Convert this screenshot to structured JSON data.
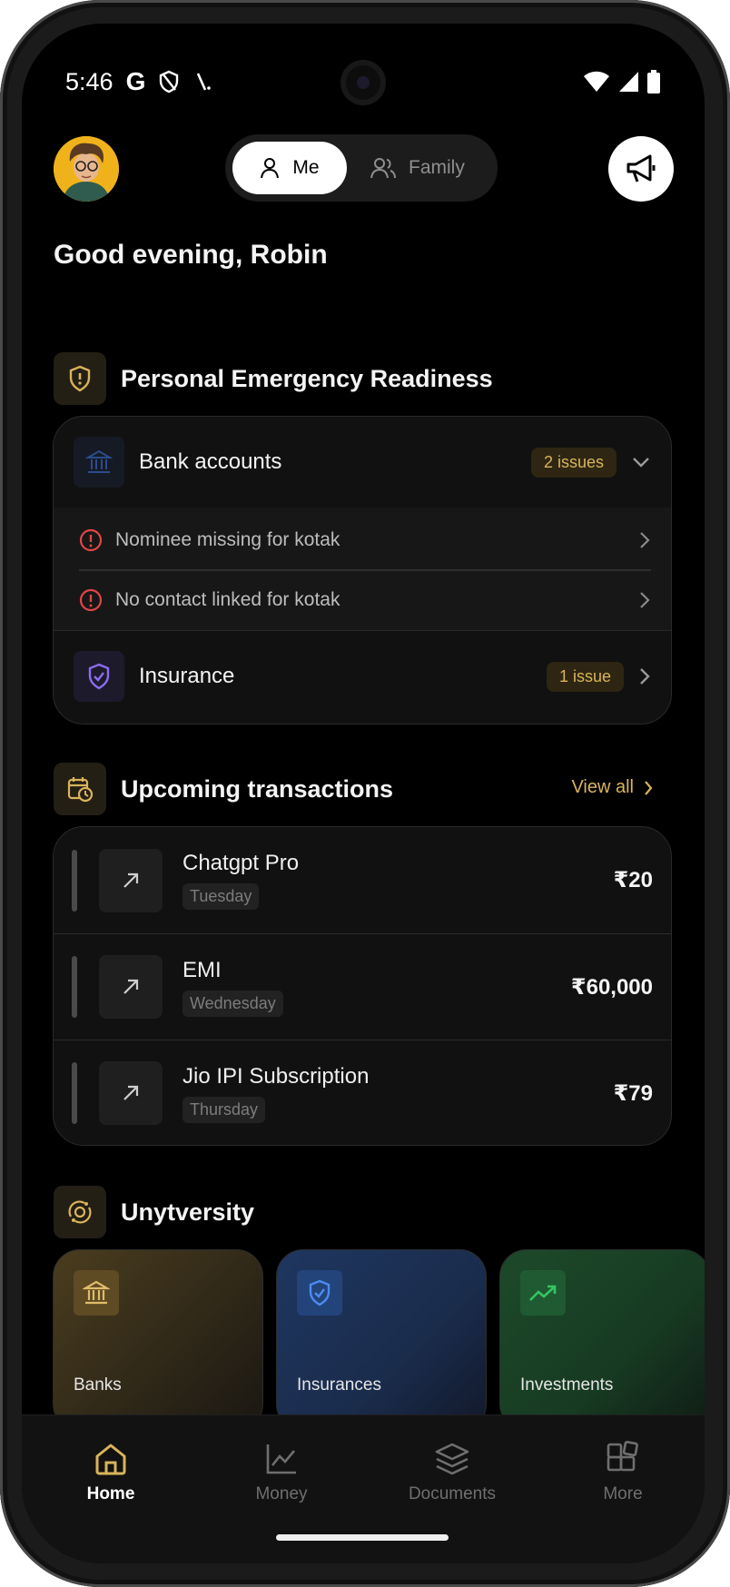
{
  "status": {
    "time": "5:46",
    "g_glyph": "G"
  },
  "header": {
    "segment": {
      "me": "Me",
      "family": "Family"
    }
  },
  "greeting": "Good evening, Robin",
  "readiness": {
    "title": "Personal Emergency Readiness",
    "bank": {
      "label": "Bank accounts",
      "badge": "2 issues",
      "issues": [
        "Nominee missing for kotak",
        "No contact linked for kotak"
      ]
    },
    "insurance": {
      "label": "Insurance",
      "badge": "1 issue"
    }
  },
  "transactions": {
    "title": "Upcoming transactions",
    "view_all": "View all",
    "items": [
      {
        "name": "Chatgpt Pro",
        "day": "Tuesday",
        "amount": "₹20"
      },
      {
        "name": "EMI",
        "day": "Wednesday",
        "amount": "₹60,000"
      },
      {
        "name": "Jio IPI Subscription",
        "day": "Thursday",
        "amount": "₹79"
      }
    ]
  },
  "university": {
    "title": "Unytversity",
    "tiles": [
      {
        "label": "Banks",
        "icon": "bank-icon",
        "color": "#c9a35a"
      },
      {
        "label": "Insurances",
        "icon": "shield-check-icon",
        "color": "#3d7be8"
      },
      {
        "label": "Investments",
        "icon": "trend-up-icon",
        "color": "#2fbf5a"
      }
    ]
  },
  "nav": {
    "home": "Home",
    "money": "Money",
    "documents": "Documents",
    "more": "More"
  },
  "colors": {
    "accent": "#d9b45a",
    "danger": "#e04646",
    "background": "#000000"
  }
}
